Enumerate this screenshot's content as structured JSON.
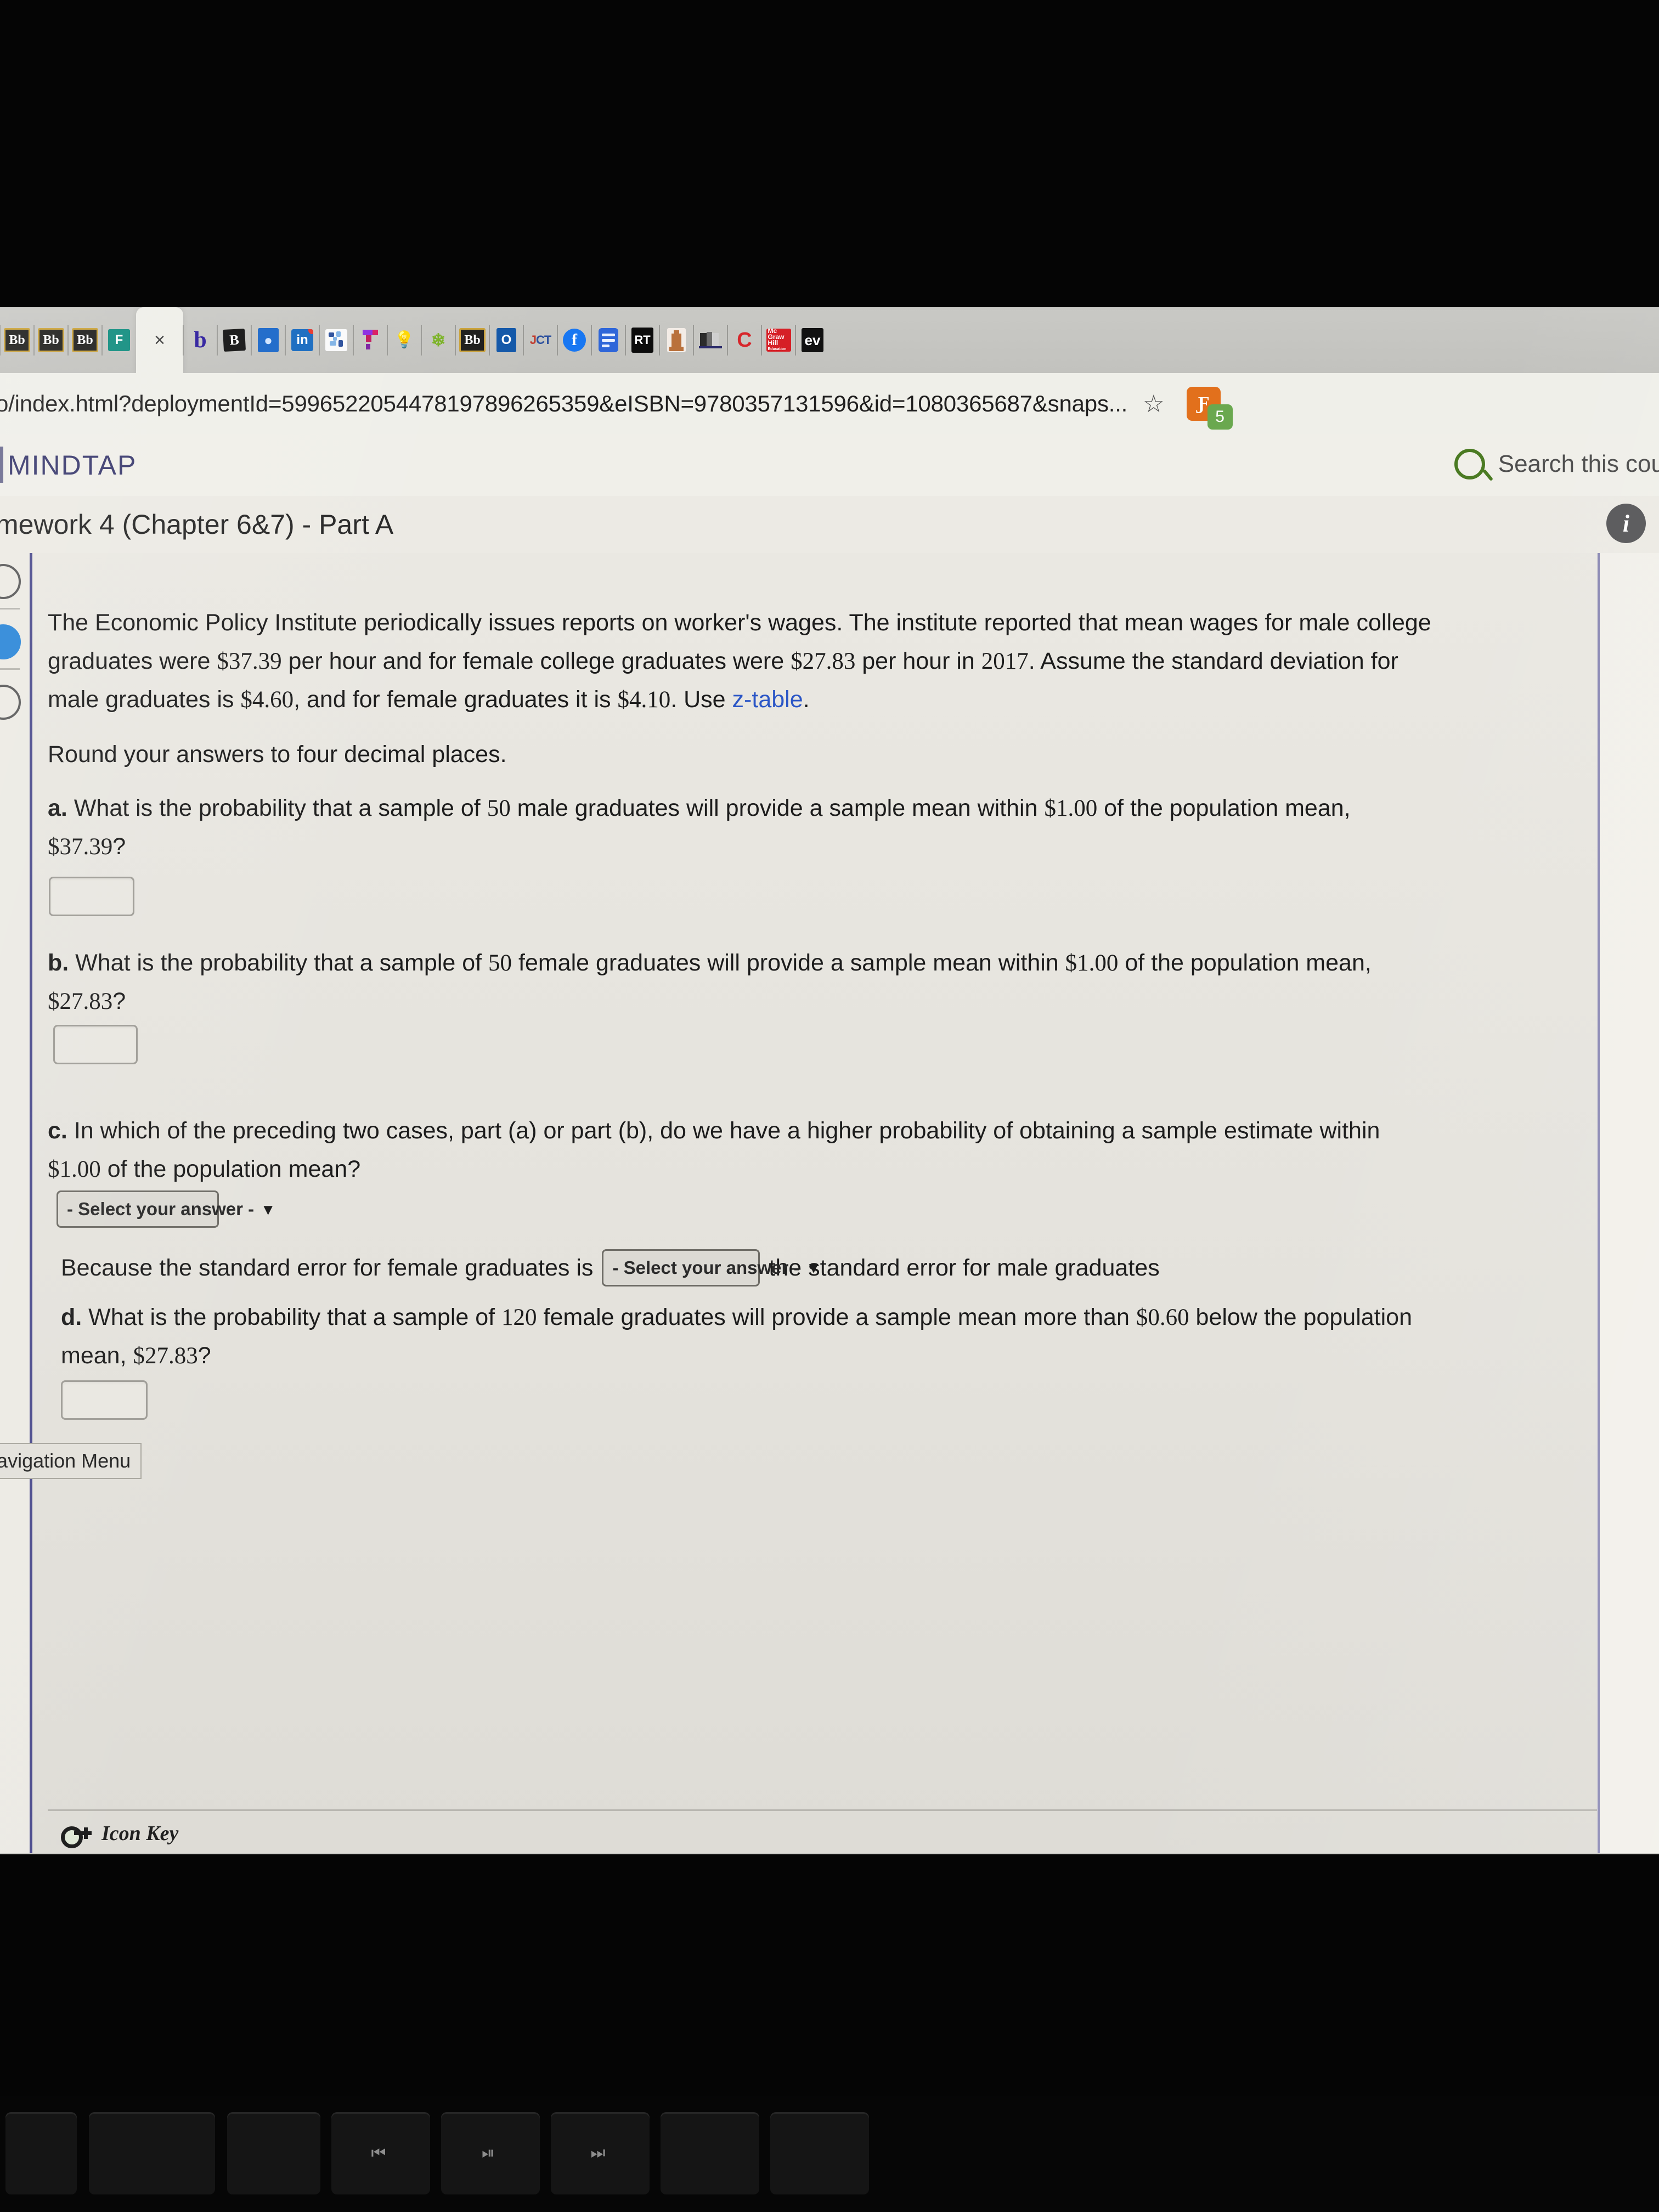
{
  "browser": {
    "url": "o/index.html?deploymentId=599652205447819789626535 9&eISBN=9780357131596&id=1080365687&snaps...",
    "url_display": "o/index.html?deploymentId=5996522054478197896265359&eISBN=9780357131596&id=1080365687&snaps...",
    "bookmark_star": "☆",
    "extension_badge_count": "5",
    "tabs": [
      {
        "name": "blackboard-tab-1",
        "icon": "blackboard-icon",
        "label": "Bb",
        "active": false
      },
      {
        "name": "blackboard-tab-2",
        "icon": "blackboard-icon",
        "label": "Bb",
        "active": false
      },
      {
        "name": "blackboard-tab-3",
        "icon": "blackboard-icon",
        "label": "Bb",
        "active": false
      },
      {
        "name": "microsoft-forms-tab",
        "icon": "microsoft-forms-icon",
        "label": "F",
        "active": false
      },
      {
        "name": "mindtap-tab",
        "icon": "close-x-icon",
        "label": "×",
        "active": true
      },
      {
        "name": "bitly-b-tab",
        "icon": "letter-b-icon",
        "label": "b",
        "active": false
      },
      {
        "name": "bitly-tab",
        "icon": "bitly-icon",
        "label": "B",
        "active": false
      },
      {
        "name": "globe-tab",
        "icon": "globe-icon",
        "label": "",
        "active": false
      },
      {
        "name": "linkedin-tab",
        "icon": "linkedin-icon",
        "label": "in",
        "active": false
      },
      {
        "name": "paint-tab",
        "icon": "paint-palette-icon",
        "label": "",
        "active": false
      },
      {
        "name": "tetris-tab",
        "icon": "tetris-blocks-icon",
        "label": "",
        "active": false
      },
      {
        "name": "bulb-tab",
        "icon": "lightbulb-icon",
        "label": "",
        "active": false
      },
      {
        "name": "leaf-tab",
        "icon": "leaf-icon",
        "label": "",
        "active": false
      },
      {
        "name": "blackboard-tab-4",
        "icon": "blackboard-icon",
        "label": "Bb",
        "active": false
      },
      {
        "name": "outlook-tab",
        "icon": "outlook-icon",
        "label": "O",
        "active": false
      },
      {
        "name": "jct-tab",
        "icon": "jct-logo-icon",
        "label": "JCT",
        "active": false
      },
      {
        "name": "facebook-tab",
        "icon": "facebook-icon",
        "label": "f",
        "active": false
      },
      {
        "name": "google-docs-tab",
        "icon": "document-icon",
        "label": "",
        "active": false
      },
      {
        "name": "rt-tab",
        "icon": "rotten-tomatoes-icon",
        "label": "RT",
        "active": false
      },
      {
        "name": "pillar-tab",
        "icon": "monument-icon",
        "label": "",
        "active": false
      },
      {
        "name": "dark-logo-tab",
        "icon": "dark-logo-icon",
        "label": "",
        "active": false
      },
      {
        "name": "cengage-tab",
        "icon": "cengage-icon",
        "label": "C",
        "active": false
      },
      {
        "name": "mcgraw-hill-tab",
        "icon": "mcgraw-hill-icon",
        "label": "Mc Graw Hill",
        "active": false
      },
      {
        "name": "evernote-tab",
        "icon": "evernote-icon",
        "label": "ev",
        "active": false
      }
    ],
    "mcgraw_lines": [
      "Mc",
      "Graw",
      "Hill",
      "Education"
    ]
  },
  "app_header": {
    "logo": "MINDTAP",
    "search_label": "Search this cou",
    "search_icon": "search-icon"
  },
  "assignment": {
    "title": "mework 4 (Chapter 6&7) - Part A",
    "info_icon": "info-icon",
    "info_glyph": "i"
  },
  "tooltip": {
    "text": "ons Navigation Menu"
  },
  "question": {
    "intro_line1": "The Economic Policy Institute periodically issues reports on worker's wages. The institute reported that mean wages for male college",
    "intro_line2_a": "graduates were ",
    "intro_line2_v1": "$37.39",
    "intro_line2_b": " per hour and for female college graduates were ",
    "intro_line2_v2": "$27.83",
    "intro_line2_c": " per hour in ",
    "intro_line2_v3": "2017",
    "intro_line2_d": ". Assume the standard deviation for",
    "intro_line3_a": "male graduates is ",
    "intro_line3_v1": "$4.60",
    "intro_line3_b": ", and for female graduates it is ",
    "intro_line3_v2": "$4.10",
    "intro_line3_c": ". Use ",
    "intro_line3_link": "z-table",
    "intro_line3_d": ".",
    "rounding": "Round your answers to four decimal places.",
    "a_label": "a.",
    "a_text1": " What is the probability that a sample of ",
    "a_n": "50",
    "a_text2": " male graduates will provide a sample mean within ",
    "a_within": "$1.00",
    "a_text3": " of the population mean,",
    "a_mean": "$37.39",
    "a_text4": "?",
    "a_answer_value": "",
    "b_label": "b.",
    "b_text1": " What is the probability that a sample of ",
    "b_n": "50",
    "b_text2": " female graduates will provide a sample mean within ",
    "b_within": "$1.00",
    "b_text3": " of the population mean,",
    "b_mean": "$27.83",
    "b_text4": "?",
    "b_answer_value": "",
    "c_label": "c.",
    "c_text1": " In which of the preceding two cases, part (a) or part (b), do we have a higher probability of obtaining a sample estimate within",
    "c_within": "$1.00",
    "c_text2": " of the population mean?",
    "c_select_value": "- Select your answer -",
    "because_text1": "Because the standard error for female graduates is",
    "because_select_value": "- Select your answer -",
    "because_text2": "the standard error for male graduates",
    "d_label": "d.",
    "d_text1": " What is the probability that a sample of ",
    "d_n": "120",
    "d_text2": " female graduates will provide a sample mean more than ",
    "d_below": "$0.60",
    "d_text3": " below the population",
    "d_text4": "mean, ",
    "d_mean": "$27.83",
    "d_text5": "?",
    "d_answer_value": "",
    "chevron": "⌄"
  },
  "footer": {
    "icon_key_label": "Icon Key",
    "icon_key_glyph": "key-icon"
  }
}
